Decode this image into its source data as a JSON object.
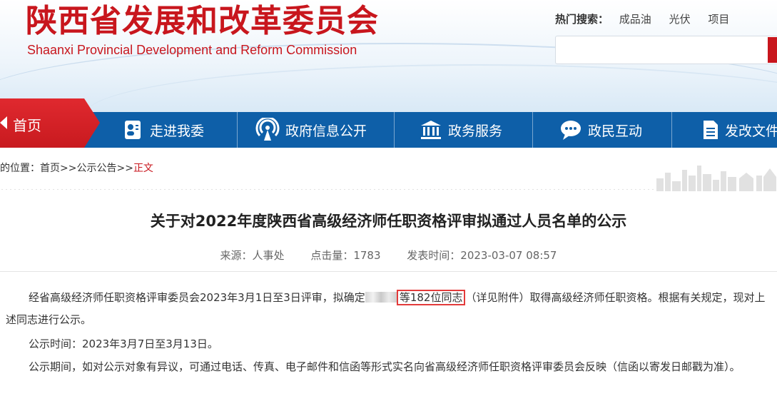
{
  "header": {
    "logo_cn": "陕西省发展和改革委员会",
    "logo_en": "Shaanxi Provincial Development and Reform Commission",
    "hot_label": "热门搜索：",
    "hot_keywords": [
      "成品油",
      "光伏",
      "项目"
    ],
    "search_placeholder": ""
  },
  "nav": {
    "home": "首页",
    "items": [
      "走进我委",
      "政府信息公开",
      "政务服务",
      "政民互动",
      "发改文件"
    ]
  },
  "breadcrumb": {
    "prefix": "的位置：",
    "home": "首页",
    "sep1": ">>",
    "section": "公示公告",
    "sep2": ">>",
    "current": "正文"
  },
  "article": {
    "title": "关于对2022年度陕西省高级经济师任职资格评审拟通过人员名单的公示",
    "source": "来源：人事处",
    "clicks": "点击量：1783",
    "published": "发表时间：2023-03-07 08:57",
    "p1_before": "经省高级经济师任职资格评审委员会2023年3月1日至3日评审，拟确定",
    "p1_highlight": "等182位同志",
    "p1_after": "（详见附件）取得高级经济师任职资格。根据有关规定，现对上述同志进行公示。",
    "p2": "公示时间：2023年3月7日至3月13日。",
    "p3": "公示期间，如对公示对象有异议，可通过电话、传真、电子邮件和信函等形式实名向省高级经济师任职资格评审委员会反映（信函以寄发日邮戳为准）。"
  },
  "colors": {
    "brand_red": "#c8161d",
    "nav_blue": "#0e5fa8",
    "highlight_border": "#e33b3b"
  },
  "icons": [
    "profile-card-icon",
    "broadcast-icon",
    "government-building-icon",
    "chat-bubble-icon",
    "document-icon"
  ]
}
